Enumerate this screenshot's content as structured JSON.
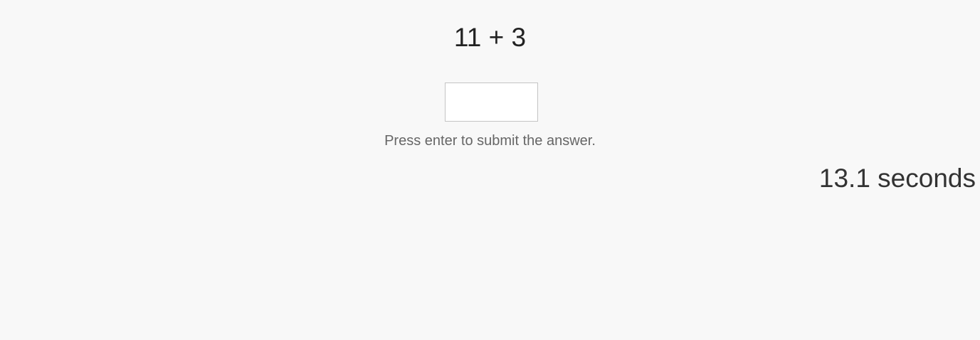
{
  "game": {
    "problem": "11 + 3",
    "answer_value": "",
    "hint": "Press enter to submit the answer.",
    "timer": "13.1 seconds"
  },
  "colors": {
    "background": "#f8f8f8",
    "text": "#222222",
    "hint_text": "#666666",
    "input_border": "#c4c4c4"
  }
}
